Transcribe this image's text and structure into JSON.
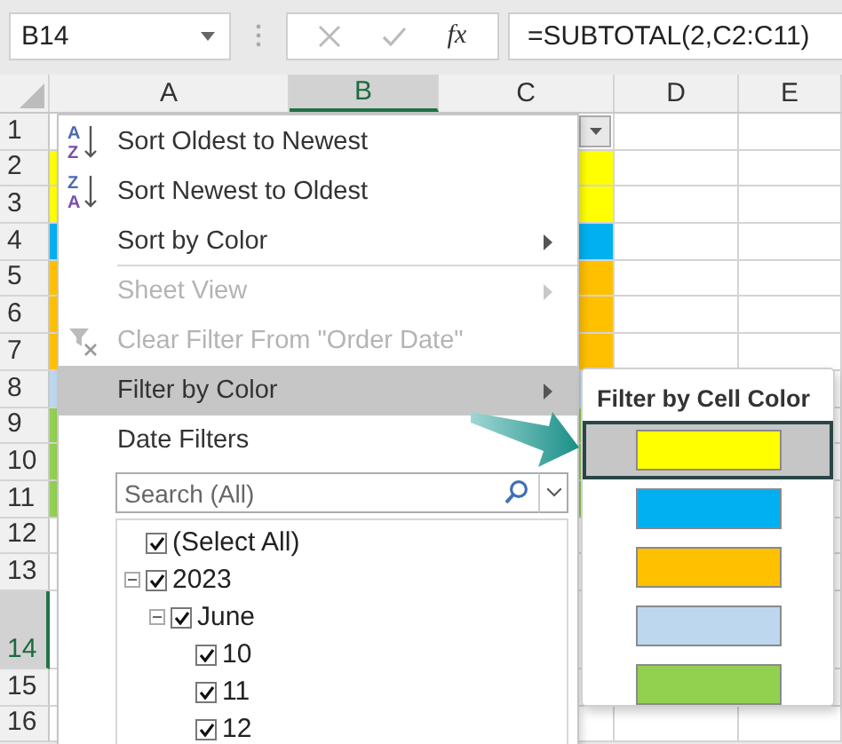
{
  "formula_bar": {
    "name_box": "B14",
    "function_label": "fx",
    "formula": "=SUBTOTAL(2,C2:C11)"
  },
  "columns": [
    {
      "label": "A",
      "selected": false
    },
    {
      "label": "B",
      "selected": true
    },
    {
      "label": "C",
      "selected": false
    },
    {
      "label": "D",
      "selected": false
    },
    {
      "label": "E",
      "selected": false
    }
  ],
  "rows": [
    {
      "label": "1",
      "selected": false,
      "tall": false
    },
    {
      "label": "2",
      "selected": false,
      "tall": false,
      "color": "#ffff00"
    },
    {
      "label": "3",
      "selected": false,
      "tall": false,
      "color": "#ffff00"
    },
    {
      "label": "4",
      "selected": false,
      "tall": false,
      "color": "#00b0f0"
    },
    {
      "label": "5",
      "selected": false,
      "tall": false,
      "color": "#ffc000"
    },
    {
      "label": "6",
      "selected": false,
      "tall": false,
      "color": "#ffc000"
    },
    {
      "label": "7",
      "selected": false,
      "tall": false,
      "color": "#ffc000"
    },
    {
      "label": "8",
      "selected": false,
      "tall": false,
      "color": "#bdd7ee"
    },
    {
      "label": "9",
      "selected": false,
      "tall": false,
      "color": "#92d050"
    },
    {
      "label": "10",
      "selected": false,
      "tall": false,
      "color": "#92d050"
    },
    {
      "label": "11",
      "selected": false,
      "tall": false,
      "color": "#92d050"
    },
    {
      "label": "12",
      "selected": false,
      "tall": false
    },
    {
      "label": "13",
      "selected": false,
      "tall": false
    },
    {
      "label": "14",
      "selected": true,
      "tall": true
    },
    {
      "label": "15",
      "selected": false,
      "tall": false
    },
    {
      "label": "16",
      "selected": false,
      "tall": false
    }
  ],
  "filter_menu": {
    "items": [
      {
        "label": "Sort Oldest to Newest",
        "kind": "sort",
        "icon_letters": [
          "A",
          "Z"
        ],
        "disabled": false,
        "submenu": false,
        "selected": false,
        "separator_after": false
      },
      {
        "label": "Sort Newest to Oldest",
        "kind": "sort",
        "icon_letters": [
          "Z",
          "A"
        ],
        "disabled": false,
        "submenu": false,
        "selected": false,
        "separator_after": false
      },
      {
        "label": "Sort by Color",
        "kind": "plain",
        "disabled": false,
        "submenu": true,
        "selected": false,
        "separator_after": true
      },
      {
        "label": "Sheet View",
        "kind": "plain",
        "disabled": true,
        "submenu": true,
        "selected": false,
        "separator_after": false
      },
      {
        "label": "Clear Filter From \"Order Date\"",
        "kind": "clear-filter",
        "disabled": true,
        "submenu": false,
        "selected": false,
        "separator_after": false
      },
      {
        "label": "Filter by Color",
        "kind": "plain",
        "disabled": false,
        "submenu": true,
        "selected": true,
        "separator_after": false
      },
      {
        "label": "Date Filters",
        "kind": "plain",
        "disabled": false,
        "selected": false,
        "separator_after": false
      }
    ],
    "search": {
      "placeholder": "Search (All)"
    },
    "tree": [
      {
        "label": "(Select All)",
        "checked": true
      },
      {
        "label": "2023",
        "checked": true,
        "expanded": true,
        "children": [
          {
            "label": "June",
            "checked": true,
            "expanded": true,
            "children": [
              {
                "label": "10",
                "checked": true
              },
              {
                "label": "11",
                "checked": true
              },
              {
                "label": "12",
                "checked": true
              }
            ]
          }
        ]
      }
    ]
  },
  "color_submenu": {
    "title": "Filter by Cell Color",
    "swatches": [
      {
        "color": "#ffff00",
        "selected": true
      },
      {
        "color": "#00b0f0",
        "selected": false
      },
      {
        "color": "#ffc000",
        "selected": false
      },
      {
        "color": "#bdd7ee",
        "selected": false
      },
      {
        "color": "#92d050",
        "selected": false
      }
    ]
  }
}
